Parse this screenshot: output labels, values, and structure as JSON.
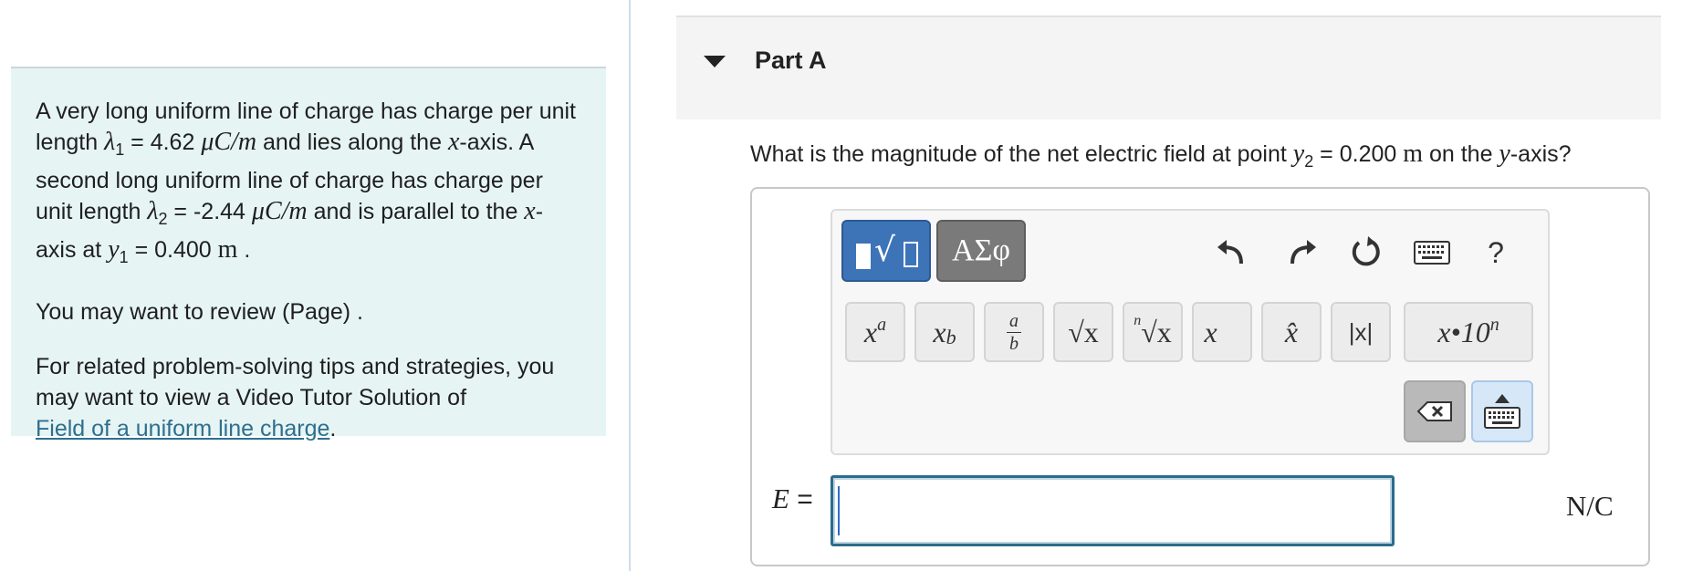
{
  "problem": {
    "p1_a": "A very long uniform line of charge has charge per unit length ",
    "lambda1_sym": "λ",
    "lambda1_sub": "1",
    "lambda1_eq": " = 4.62 ",
    "unit_uc_m": "μC/m",
    "p1_b": " and lies along the ",
    "x_var": "x",
    "p1_c": "-axis. A second long uniform line of charge has charge per unit length ",
    "lambda2_sub": "2",
    "lambda2_eq": " = -2.44 ",
    "p1_d": " and is parallel to the ",
    "p1_e": "-axis at ",
    "y_var": "y",
    "y1_sub": "1",
    "y1_eq": " = 0.400 ",
    "unit_m": "m",
    "p1_end": " .",
    "p2": "You may want to review (Page) .",
    "p3": "For related problem-solving tips and strategies, you may want to view a Video Tutor Solution of",
    "link": "Field of a uniform line charge",
    "p3_end": "."
  },
  "part": {
    "title": "Part A"
  },
  "question": {
    "q_a": "What is the magnitude of the net electric field at point ",
    "y_var": "y",
    "y2_sub": "2",
    "y2_eq": " = 0.200 ",
    "unit_m": "m",
    "q_b": " on the ",
    "q_c": "-axis?"
  },
  "toolbar": {
    "symbols_label": "ΑΣφ",
    "help_label": "?",
    "templates": {
      "power_base": "x",
      "power_exp": "a",
      "sub_base": "x",
      "sub_idx": "b",
      "frac_num": "a",
      "frac_den": "b",
      "sqrt": "√x",
      "nroot_idx": "n",
      "nroot": "√x",
      "vec": "x⃗",
      "hat": "x̂",
      "abs": "|x|",
      "sci": "x•10",
      "sci_exp": "n"
    }
  },
  "answer": {
    "label_var": "E",
    "label_eq": " =",
    "value": "",
    "unit": "N/C"
  }
}
